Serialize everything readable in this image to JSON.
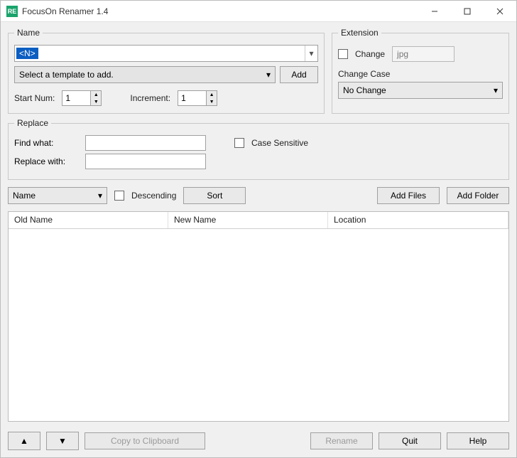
{
  "titlebar": {
    "title": "FocusOn Renamer 1.4",
    "icon_text": "RE"
  },
  "name": {
    "legend": "Name",
    "pattern_value": "<N>",
    "template_placeholder": "Select a template to add.",
    "add_label": "Add",
    "start_num_label": "Start Num:",
    "start_num_value": "1",
    "increment_label": "Increment:",
    "increment_value": "1"
  },
  "extension": {
    "legend": "Extension",
    "change_label": "Change",
    "ext_value": "jpg",
    "case_legend": "Change Case",
    "case_value": "No Change"
  },
  "replace": {
    "legend": "Replace",
    "find_label": "Find what:",
    "find_value": "",
    "replace_label": "Replace with:",
    "replace_value": "",
    "case_sensitive_label": "Case Sensitive"
  },
  "sort": {
    "field": "Name",
    "descending_label": "Descending",
    "sort_label": "Sort",
    "add_files_label": "Add Files",
    "add_folder_label": "Add Folder"
  },
  "table": {
    "col_old": "Old Name",
    "col_new": "New Name",
    "col_loc": "Location"
  },
  "footer": {
    "up_icon": "▲",
    "down_icon": "▼",
    "copy_label": "Copy to Clipboard",
    "rename_label": "Rename",
    "quit_label": "Quit",
    "help_label": "Help"
  }
}
